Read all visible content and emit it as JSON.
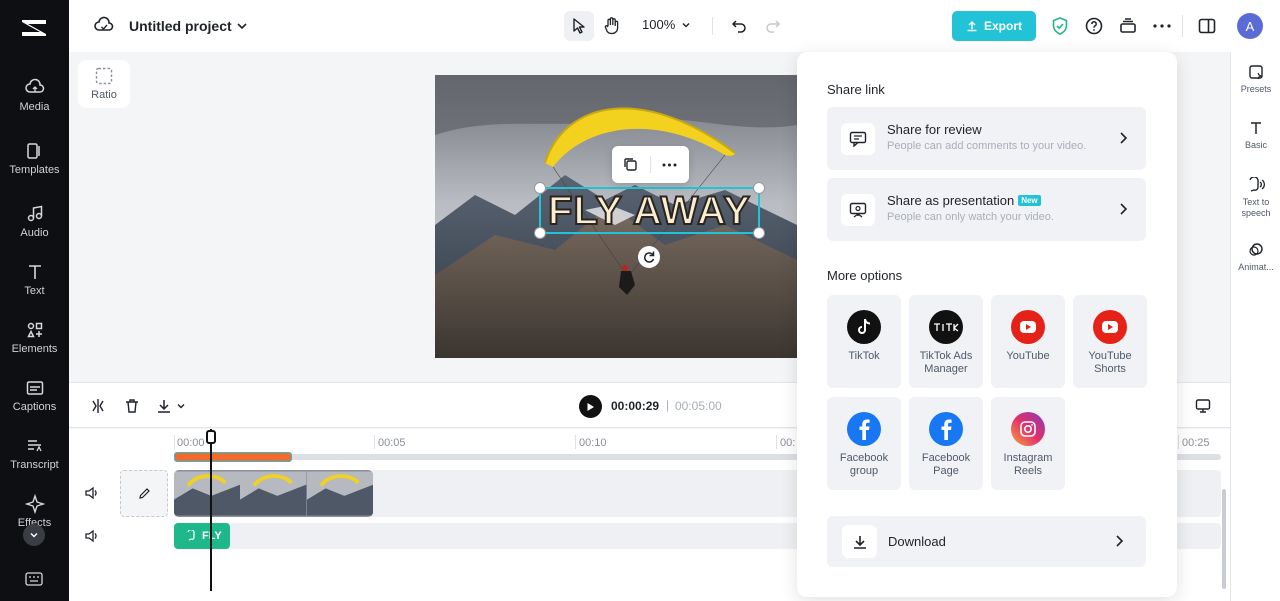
{
  "sidebar": {
    "items": [
      {
        "label": "Media",
        "icon": "cloud-upload-icon"
      },
      {
        "label": "Templates",
        "icon": "templates-icon"
      },
      {
        "label": "Audio",
        "icon": "music-note-icon"
      },
      {
        "label": "Text",
        "icon": "text-icon"
      },
      {
        "label": "Elements",
        "icon": "elements-icon"
      },
      {
        "label": "Captions",
        "icon": "captions-icon"
      },
      {
        "label": "Transcript",
        "icon": "transcript-icon"
      },
      {
        "label": "Effects",
        "icon": "effects-icon"
      }
    ]
  },
  "topbar": {
    "project_title": "Untitled project",
    "zoom": "100%",
    "export_label": "Export",
    "avatar_initial": "A"
  },
  "canvas": {
    "ratio_label": "Ratio",
    "text_overlay": "FLY AWAY"
  },
  "right_rail": {
    "items": [
      {
        "label": "Presets"
      },
      {
        "label": "Basic"
      },
      {
        "label": "Text to speech"
      },
      {
        "label": "Animat..."
      }
    ]
  },
  "playback": {
    "current_time": "00:00:29",
    "separator": "|",
    "total_time": "00:05:00"
  },
  "timeline": {
    "ticks": [
      "00:00",
      "00:05",
      "00:10",
      "00:",
      "00:25"
    ],
    "text_clip_label": "FLY"
  },
  "share_panel": {
    "share_link_title": "Share link",
    "review": {
      "title": "Share for review",
      "subtitle": "People can add comments to your video."
    },
    "presentation": {
      "title": "Share as presentation",
      "badge": "New",
      "subtitle": "People can only watch your video."
    },
    "more_options_title": "More options",
    "options": [
      {
        "label": "TikTok"
      },
      {
        "label": "TikTok Ads Manager"
      },
      {
        "label": "YouTube"
      },
      {
        "label": "YouTube Shorts"
      },
      {
        "label": "Facebook group"
      },
      {
        "label": "Facebook Page"
      },
      {
        "label": "Instagram Reels"
      }
    ],
    "download_label": "Download"
  },
  "colors": {
    "accent": "#22c3d6",
    "sidebar_bg": "#0e0f12",
    "youtube_red": "#e62117",
    "facebook_blue": "#1877f2",
    "clip_orange": "#f26b2e",
    "text_clip_green": "#1fb88a"
  }
}
